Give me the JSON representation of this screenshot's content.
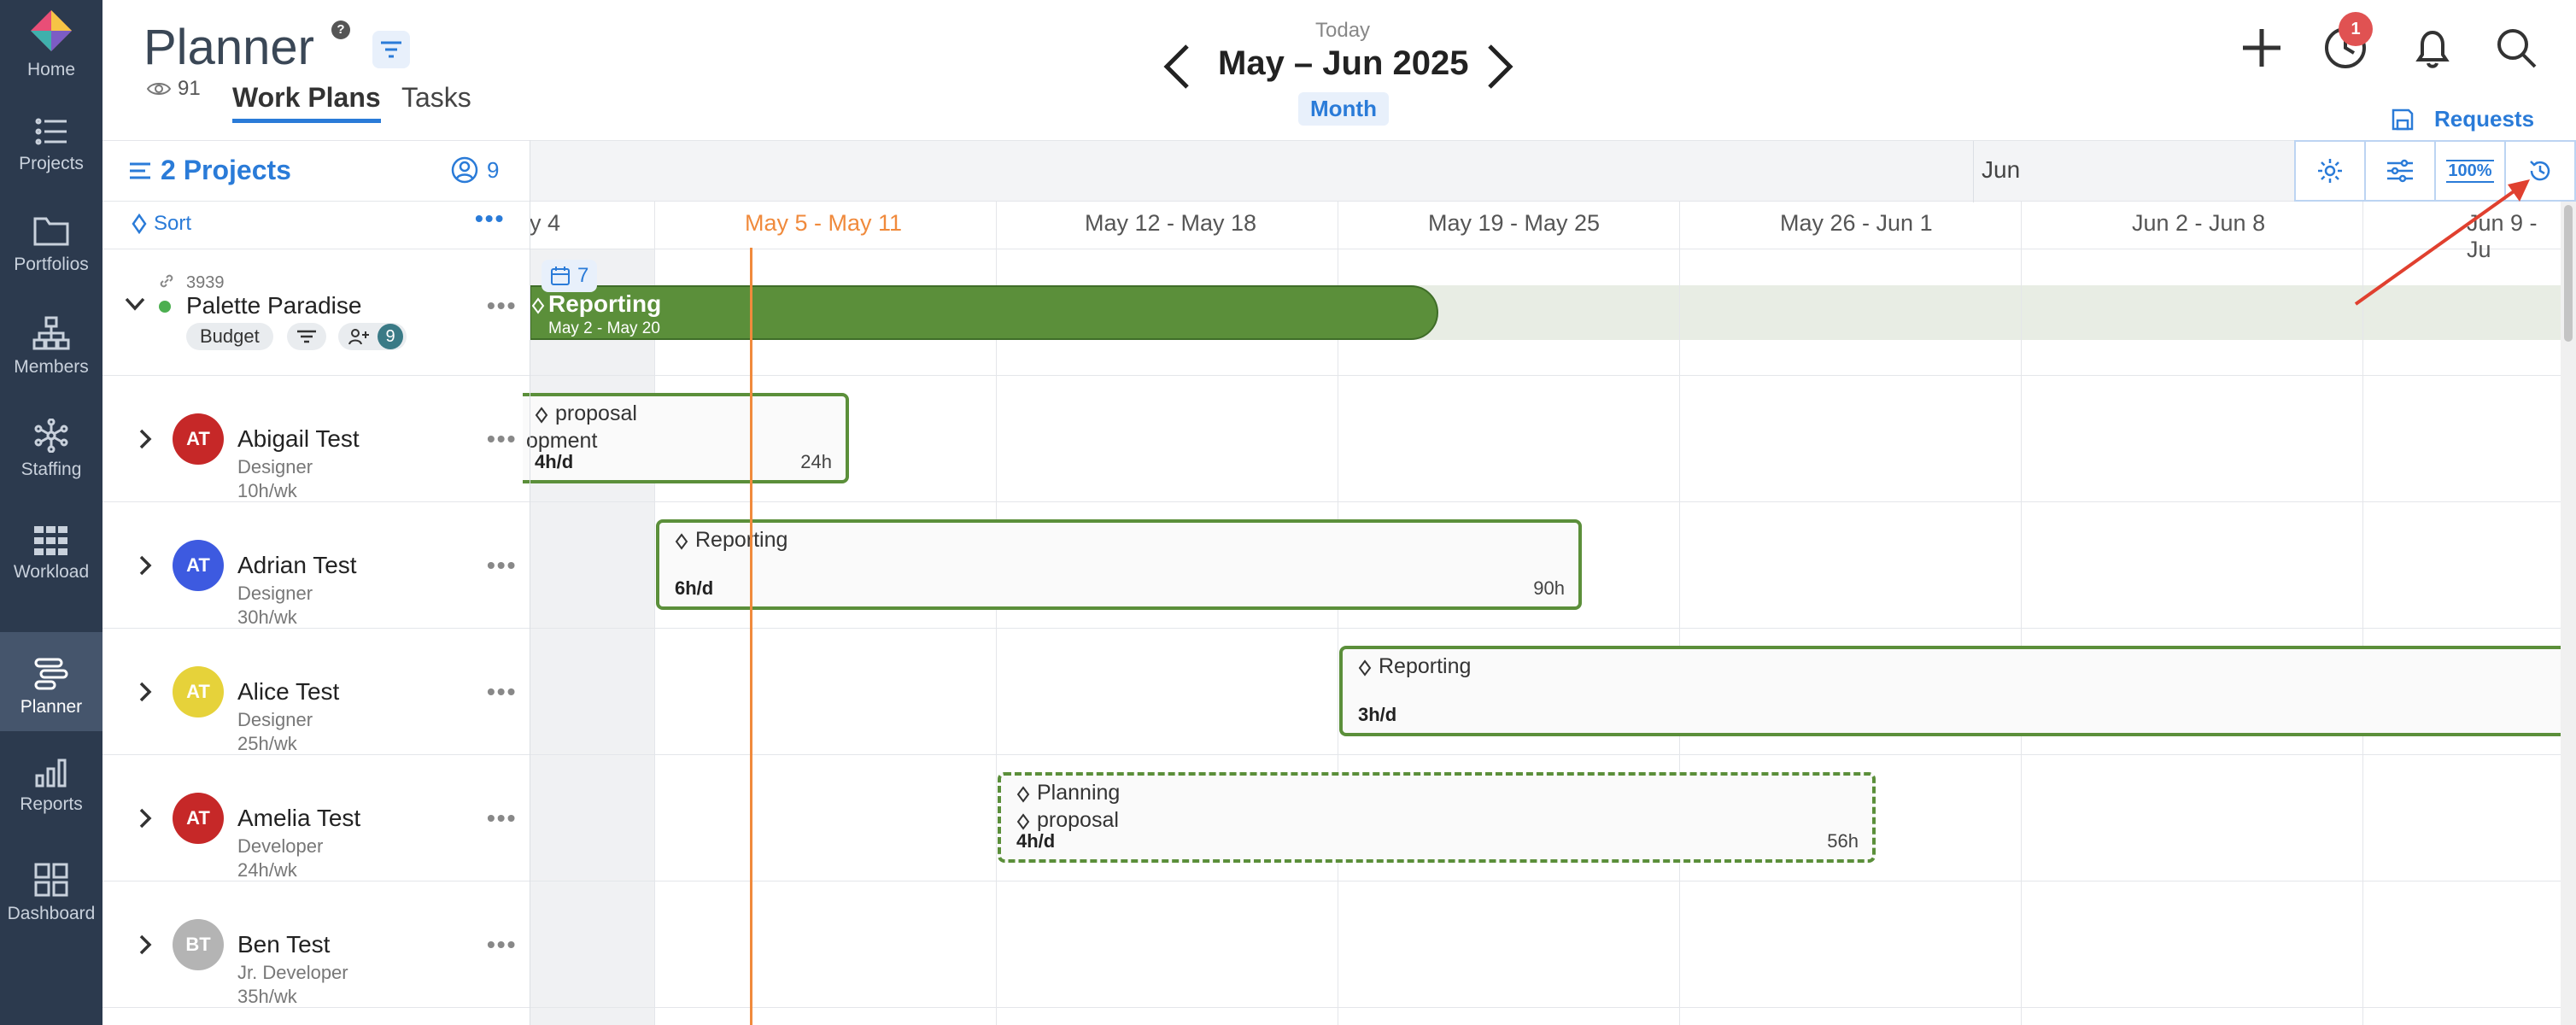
{
  "sidebar": {
    "items": [
      {
        "label": "Home",
        "icon": "home-logo-icon"
      },
      {
        "label": "Projects",
        "icon": "list-icon"
      },
      {
        "label": "Portfolios",
        "icon": "folder-icon"
      },
      {
        "label": "Members",
        "icon": "org-chart-icon"
      },
      {
        "label": "Staffing",
        "icon": "network-icon"
      },
      {
        "label": "Workload",
        "icon": "grid-icon"
      },
      {
        "label": "Planner",
        "icon": "planner-icon"
      },
      {
        "label": "Reports",
        "icon": "bar-chart-icon"
      },
      {
        "label": "Dashboard",
        "icon": "dashboard-icon"
      }
    ],
    "active": "Planner"
  },
  "header": {
    "title": "Planner",
    "help": "?",
    "views": "91",
    "tabs": [
      "Work Plans",
      "Tasks"
    ],
    "today": "Today",
    "range": "May – Jun 2025",
    "granularity": "Month",
    "notification_count": "1",
    "requests": "Requests"
  },
  "left_panel": {
    "projects_label": "2 Projects",
    "member_count": "9",
    "sort_label": "Sort"
  },
  "timeline": {
    "month_label": "Jun",
    "zoom": "100%",
    "weeks": [
      "y 4",
      "May 5 - May 11",
      "May 12 - May 18",
      "May 19 - May 25",
      "May 26 - Jun 1",
      "Jun 2 - Jun 8",
      "Jun 9 - Ju"
    ],
    "current_week_color": "#f08a3c"
  },
  "project": {
    "id": "3939",
    "name": "Palette Paradise",
    "status_color": "#4caf50",
    "chip_budget": "Budget",
    "member_badge": "9",
    "phase": {
      "name": "Reporting",
      "dates": "May 2 - May 20"
    },
    "milestone_count": "7"
  },
  "members": [
    {
      "initials": "AT",
      "name": "Abigail Test",
      "role": "Designer",
      "capacity": "10h/wk",
      "color": "#c62828",
      "bar": {
        "lines": [
          "proposal",
          "opment"
        ],
        "rate": "4h/d",
        "hours": "24h",
        "dashed": false
      }
    },
    {
      "initials": "AT",
      "name": "Adrian Test",
      "role": "Designer",
      "capacity": "30h/wk",
      "color": "#3d5ae0",
      "bar": {
        "lines": [
          "Reporting"
        ],
        "rate": "6h/d",
        "hours": "90h",
        "dashed": false
      }
    },
    {
      "initials": "AT",
      "name": "Alice Test",
      "role": "Designer",
      "capacity": "25h/wk",
      "color": "#e6d23a",
      "bar": {
        "lines": [
          "Reporting"
        ],
        "rate": "3h/d",
        "hours": "",
        "dashed": false
      }
    },
    {
      "initials": "AT",
      "name": "Amelia Test",
      "role": "Developer",
      "capacity": "24h/wk",
      "color": "#c62828",
      "bar": {
        "lines": [
          "Planning",
          "proposal"
        ],
        "rate": "4h/d",
        "hours": "56h",
        "dashed": true
      }
    },
    {
      "initials": "BT",
      "name": "Ben Test",
      "role": "Jr. Developer",
      "capacity": "35h/wk",
      "color": "#b4b4b4"
    }
  ]
}
